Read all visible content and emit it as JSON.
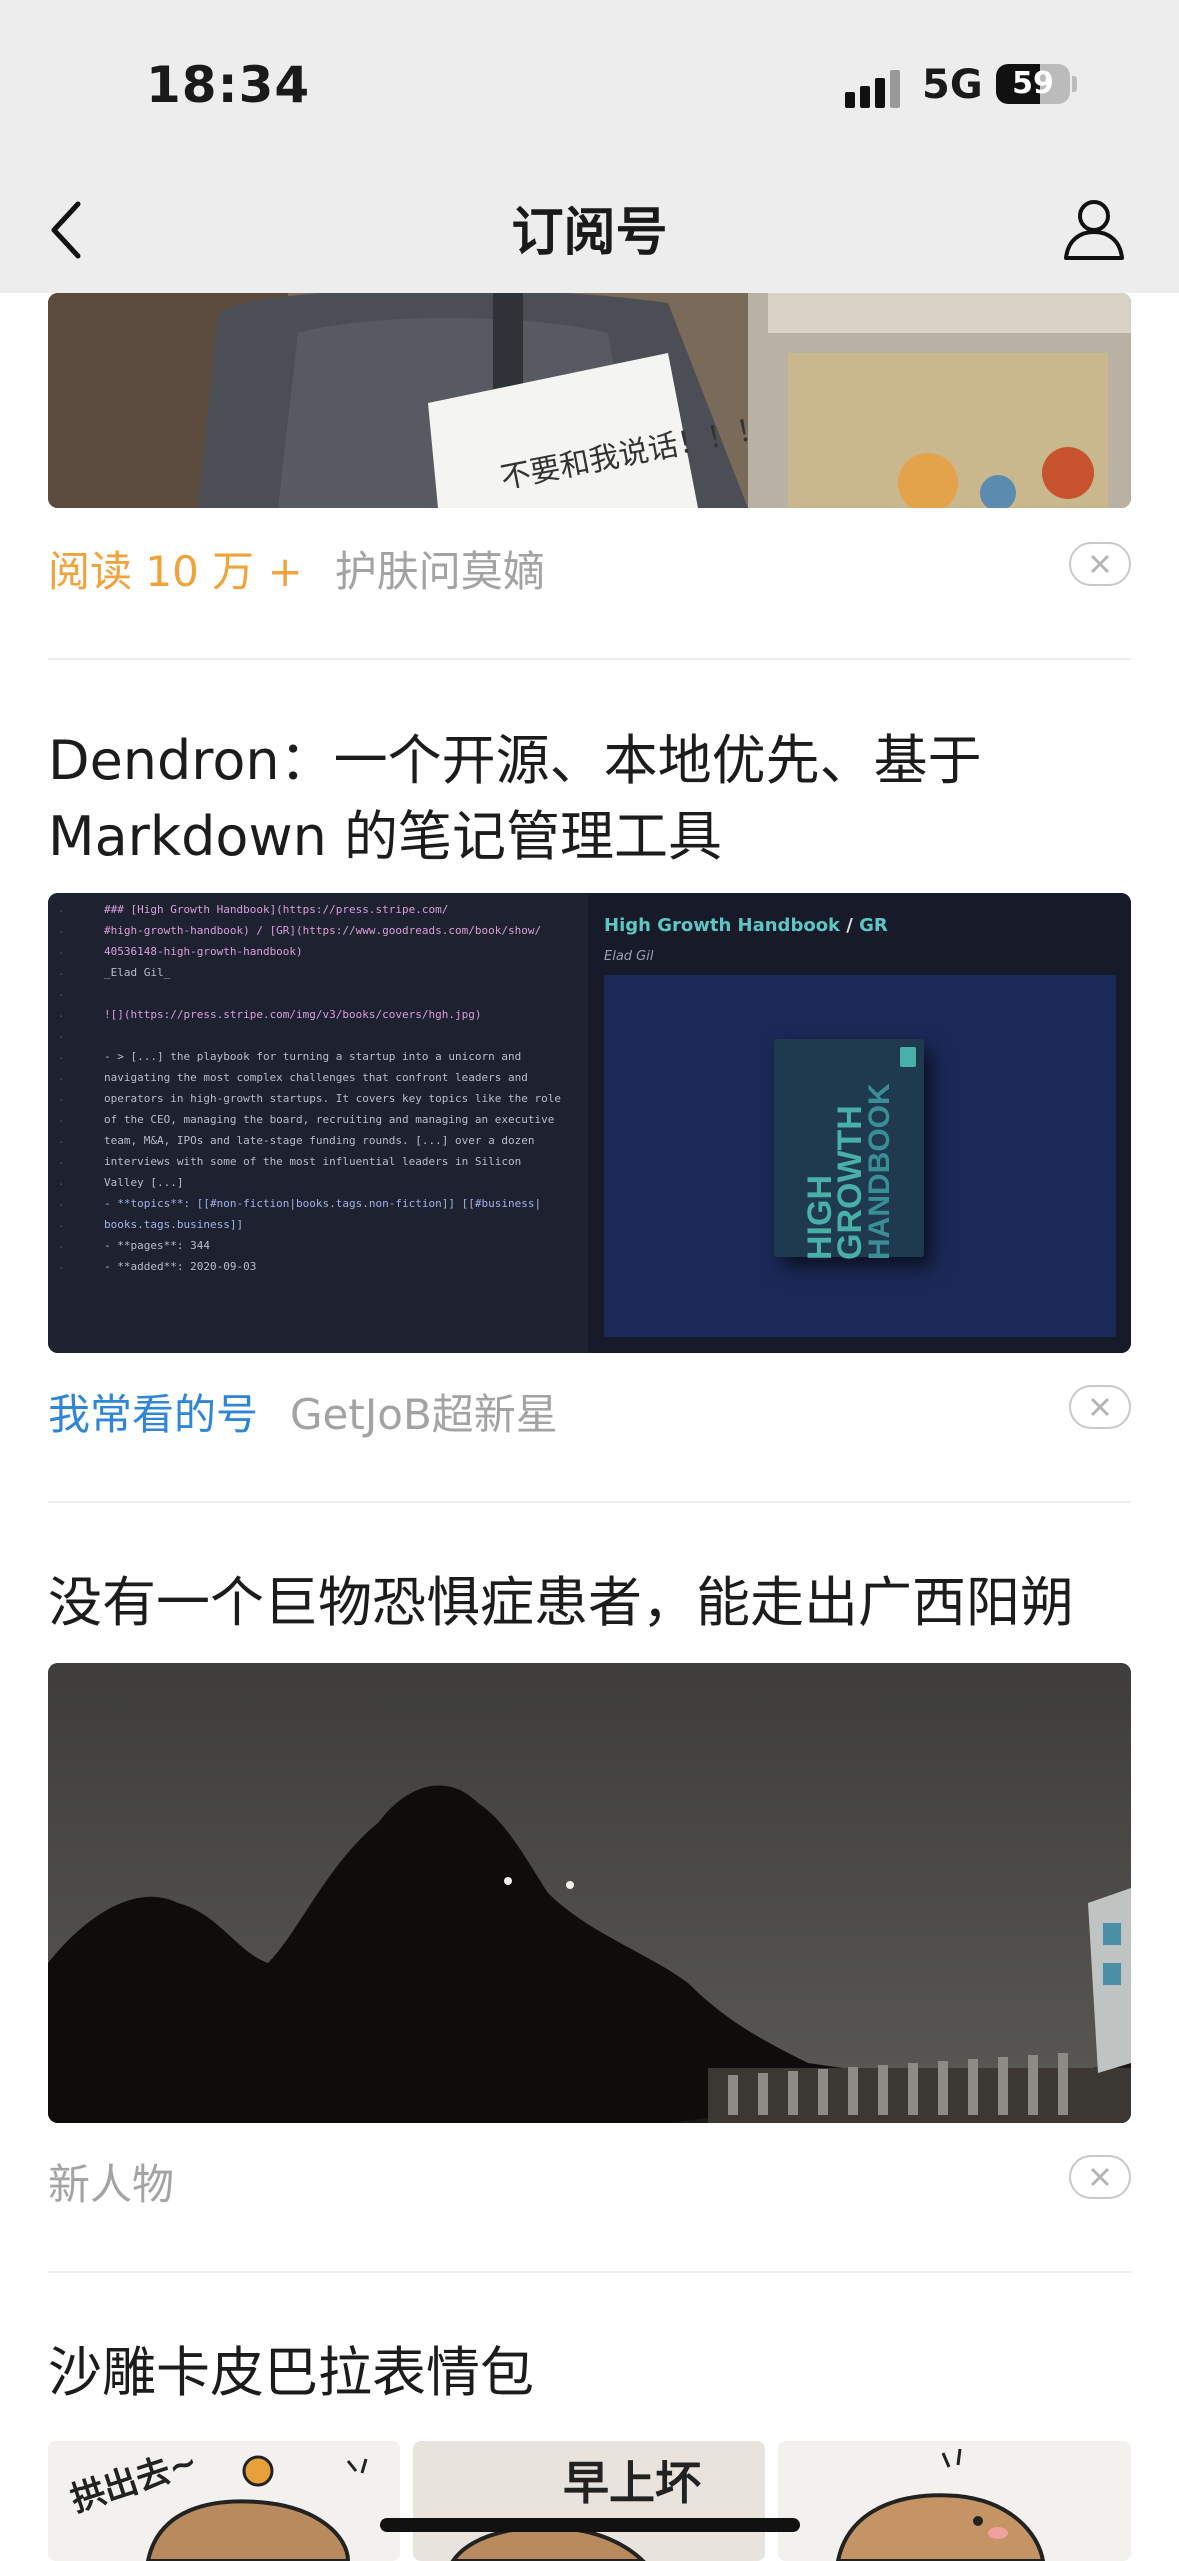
{
  "status": {
    "time": "18:34",
    "network": "5G",
    "battery": "59"
  },
  "nav": {
    "title": "订阅号"
  },
  "feed": [
    {
      "read_tag": "阅读 10 万 +",
      "source": "护肤问莫嫡",
      "image_caption": "不要和我说话！！！"
    },
    {
      "title": "Dendron：一个开源、本地优先、基于 Markdown 的笔记管理工具",
      "tag": "我常看的号",
      "source": "GetJoB超新星",
      "code_lines": [
        "### [High Growth Handbook](https://press.stripe.com/",
        "#high-growth-handbook) / [GR](https://www.goodreads.com/book/show/",
        "40536148-high-growth-handbook)",
        "_Elad Gil_",
        "",
        "![](https://press.stripe.com/img/v3/books/covers/hgh.jpg)",
        "",
        "- > [...] the playbook for turning a startup into a unicorn and",
        "navigating the most complex challenges that confront leaders and",
        "operators in high-growth startups. It covers key topics like the role",
        "of the CEO, managing the board, recruiting and managing an executive",
        "team, M&A, IPOs and late-stage funding rounds. [...] over a dozen",
        "interviews with some of the most influential leaders in Silicon",
        "Valley [...]",
        "- **topics**: [[#non-fiction|books.tags.non-fiction]] [[#business|",
        "books.tags.business]]",
        "- **pages**: 344",
        "- **added**: 2020-09-03"
      ],
      "preview_title_a": "High Growth Handbook",
      "preview_title_sep": " / ",
      "preview_title_b": "GR",
      "preview_author": "Elad Gil",
      "book_line1": "HIGH",
      "book_line2": "GROWTH",
      "book_line3": "HANDBOOK"
    },
    {
      "title": "没有一个巨物恐惧症患者，能走出广西阳朔",
      "source": "新人物"
    },
    {
      "title": "沙雕卡皮巴拉表情包",
      "sticker1": "拱出去~",
      "sticker2": "早上坏"
    }
  ]
}
